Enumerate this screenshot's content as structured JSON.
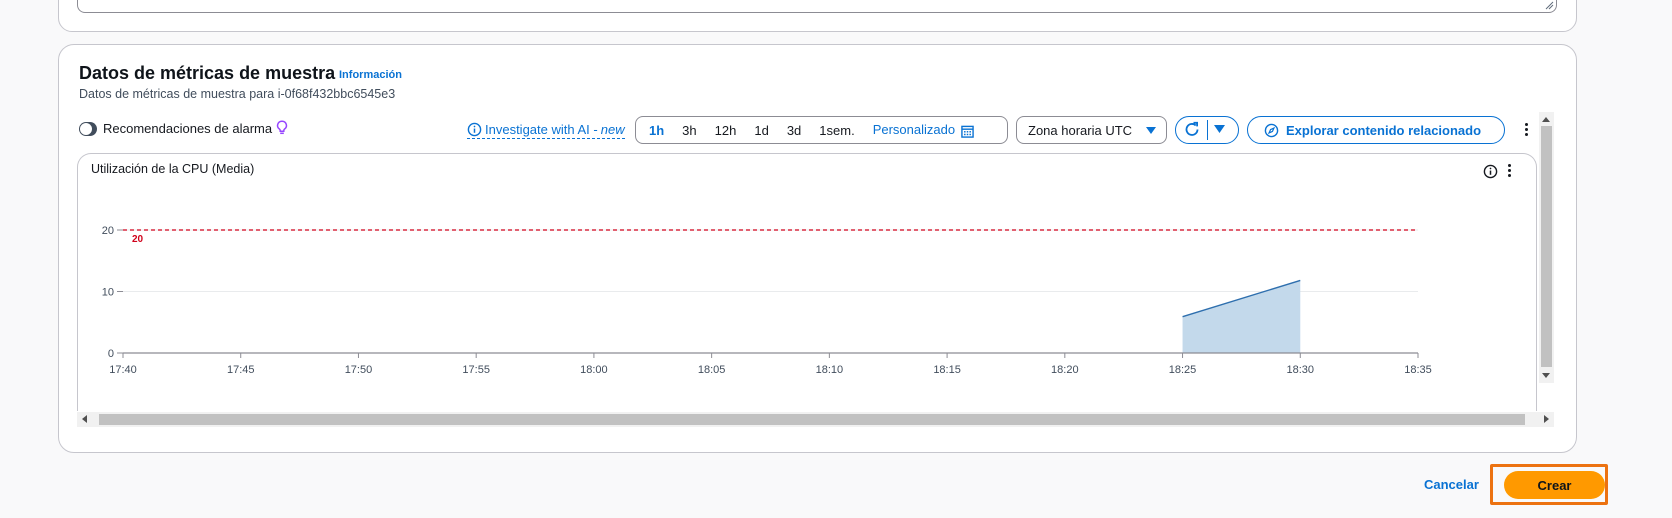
{
  "panel": {
    "title": "Datos de métricas de muestra",
    "info_link": "Información",
    "subtitle": "Datos de métricas de muestra para i-0f68f432bbc6545e3"
  },
  "toolbar": {
    "alarm_recommendations_label": "Recomendaciones de alarma",
    "alarm_recommendations_on": false,
    "investigate_label": "Investigate with AI -",
    "investigate_badge": "new",
    "time_ranges": [
      "1h",
      "3h",
      "12h",
      "1d",
      "3d",
      "1sem."
    ],
    "selected_range": "1h",
    "custom_range_label": "Personalizado",
    "timezone_label": "Zona horaria UTC",
    "explore_label": "Explorar contenido relacionado"
  },
  "widget": {
    "title": "Utilización de la CPU (Media)"
  },
  "chart_data": {
    "type": "area",
    "title": "Utilización de la CPU (Media)",
    "x_ticks": [
      "17:40",
      "17:45",
      "17:50",
      "17:55",
      "18:00",
      "18:05",
      "18:10",
      "18:15",
      "18:20",
      "18:25",
      "18:30",
      "18:35"
    ],
    "y_ticks": [
      0,
      10,
      20
    ],
    "ylim": [
      0,
      20
    ],
    "series": [
      {
        "x": [
          "18:25",
          "18:30"
        ],
        "values": [
          5.9,
          11.8
        ]
      }
    ],
    "threshold": {
      "value": 20,
      "label": "20"
    },
    "colors": {
      "area_fill": "#c3d9eb",
      "area_line": "#2e6fae",
      "threshold": "#d0021b"
    },
    "grid": true
  },
  "footer": {
    "cancel_label": "Cancelar",
    "create_label": "Crear"
  },
  "colors": {
    "link": "#0972d3",
    "primary_button": "#ff9900",
    "focus_ring": "#ec7211"
  }
}
